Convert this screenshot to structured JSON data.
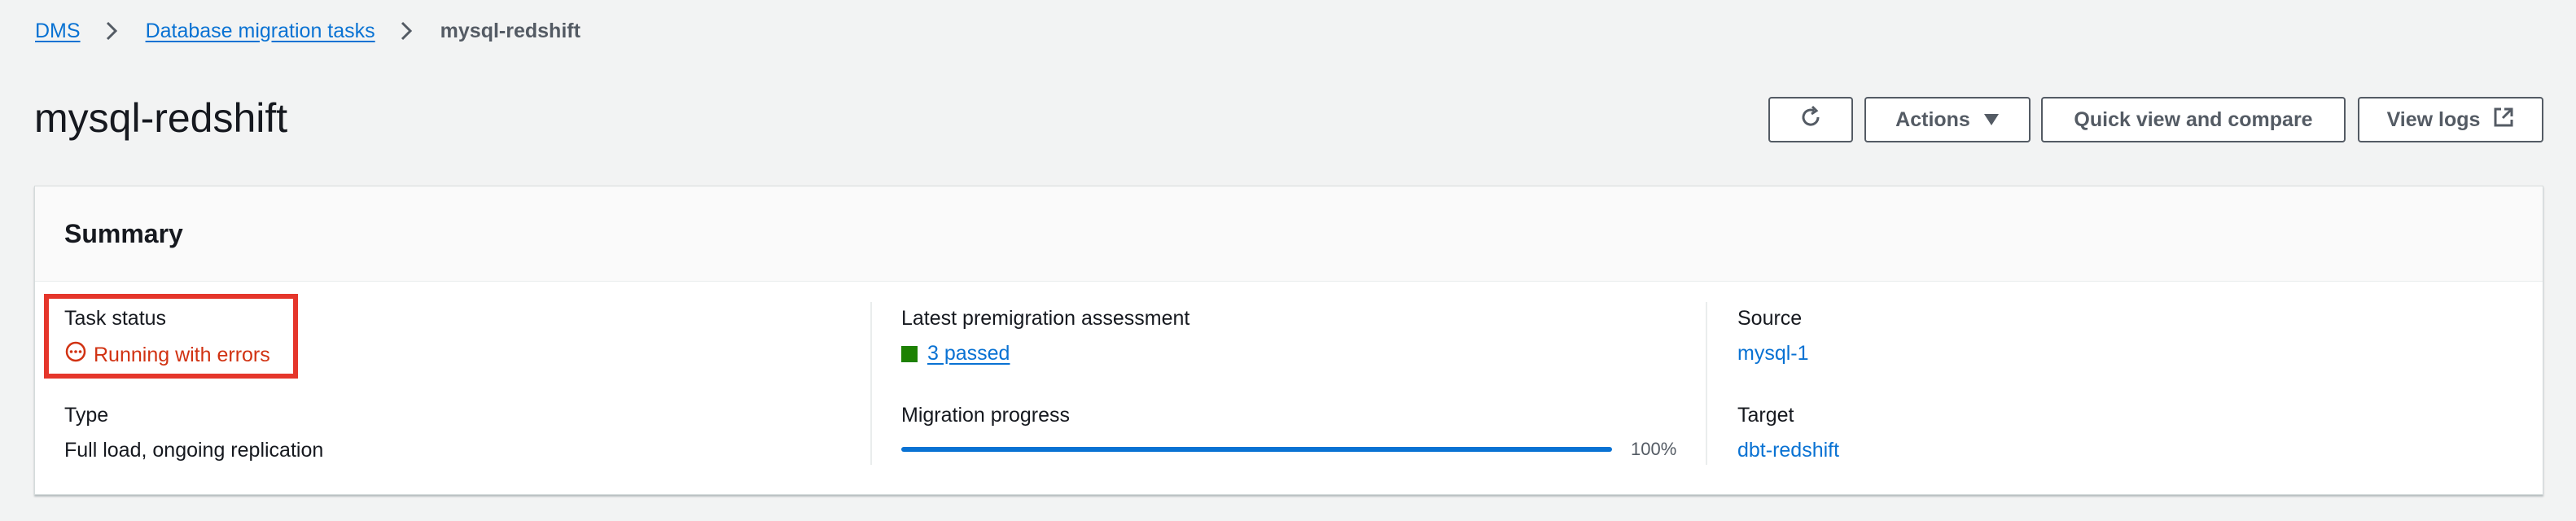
{
  "breadcrumb": {
    "items": [
      {
        "label": "DMS"
      },
      {
        "label": "Database migration tasks"
      },
      {
        "label": "mysql-redshift"
      }
    ]
  },
  "page": {
    "title": "mysql-redshift"
  },
  "header_buttons": {
    "refresh_icon": "refresh-icon",
    "actions_label": "Actions",
    "quick_view_label": "Quick view and compare",
    "view_logs_label": "View logs",
    "external_icon": "external-link-icon"
  },
  "summary": {
    "title": "Summary",
    "task_status": {
      "label": "Task status",
      "value": "Running with errors",
      "icon": "status-in-progress-icon",
      "color": "#d13212"
    },
    "type": {
      "label": "Type",
      "value": "Full load, ongoing replication"
    },
    "premigration": {
      "label": "Latest premigration assessment",
      "value": "3 passed",
      "color": "#1d8102"
    },
    "migration_progress": {
      "label": "Migration progress",
      "percent": 100,
      "percent_label": "100%"
    },
    "source": {
      "label": "Source",
      "value": "mysql-1"
    },
    "target": {
      "label": "Target",
      "value": "dbt-redshift"
    }
  },
  "colors": {
    "link": "#0972d3",
    "highlight": "#e5362b",
    "error": "#d13212",
    "success": "#1d8102"
  }
}
